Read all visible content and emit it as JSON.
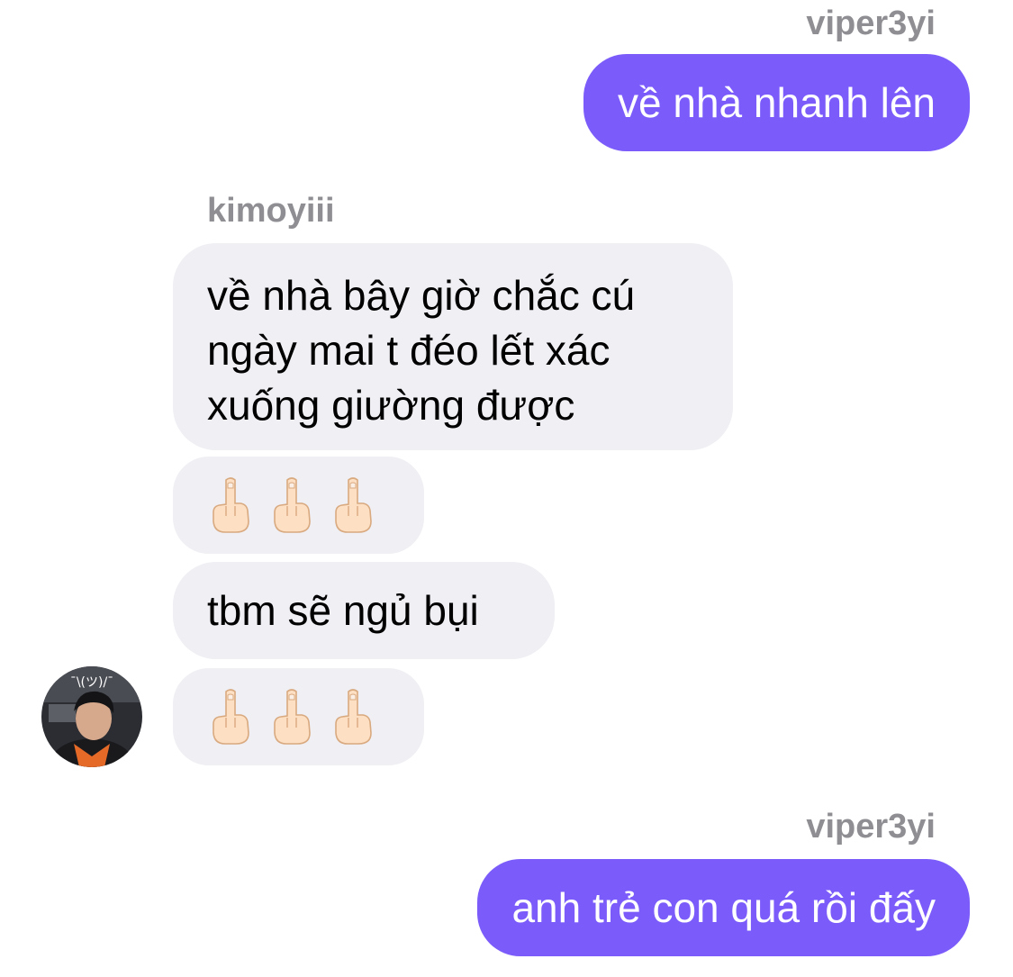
{
  "colors": {
    "outgoing_bubble": "#7b5cfa",
    "incoming_bubble": "#efeff4",
    "sender_name": "#8e8e93"
  },
  "messages": [
    {
      "sender": "viper3yi",
      "text": "về nhà nhanh lên"
    },
    {
      "sender": "kimoyiii",
      "text": "về nhà bây giờ chắc cú ngày mai t đéo lết xác xuống giường được"
    },
    {
      "type": "emoji",
      "emoji": "middle-finger",
      "count": 3
    },
    {
      "text": "tbm sẽ ngủ bụi"
    },
    {
      "type": "emoji",
      "emoji": "middle-finger",
      "count": 3
    },
    {
      "sender": "viper3yi",
      "text": "anh trẻ con quá rồi đấy"
    }
  ],
  "avatar": {
    "icon": "user-avatar-photo"
  }
}
